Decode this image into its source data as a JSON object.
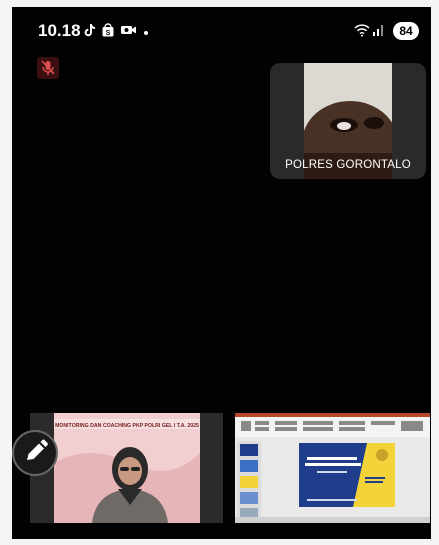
{
  "status_bar": {
    "time": "10.18",
    "battery": "84",
    "icons": [
      "tiktok-icon",
      "shopee-bag-icon",
      "video-camera-icon",
      "wifi-icon",
      "signal-icon"
    ]
  },
  "call": {
    "mic_state": "muted",
    "self_tile_label": "POLRES GORONTALO",
    "presenter_banner": "MONITORING DAN COACHING PKP POLRI GEL I T.A. 2025",
    "slide_title": "SOSIALISASI BUKU PANDUAN PERSYARATAN PENERBITAN SERTIFIKASI MUTU"
  },
  "colors": {
    "background": "#020202",
    "slide_blue": "#1f3d8a",
    "slide_yellow": "#f2d33a",
    "banner_pink": "#efc4c7"
  }
}
